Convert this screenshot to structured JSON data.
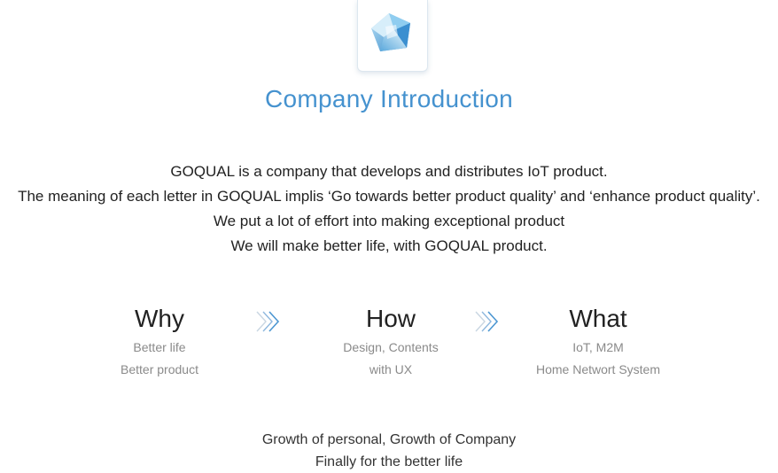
{
  "header": {
    "logo_icon": "pentagon-gem-logo-icon",
    "title": "Company Introduction",
    "title_color": "#4592cf"
  },
  "intro": {
    "lines": [
      "GOQUAL is a company that develops and distributes IoT product.",
      "The meaning of each letter in GOQUAL implis ‘Go towards better product quality’ and ‘enhance product quality’.",
      "We put a lot of effort into making exceptional product",
      "We will make better life, with GOQUAL product."
    ]
  },
  "pillars": [
    {
      "heading": "Why",
      "lines": [
        "Better life",
        "Better product"
      ]
    },
    {
      "heading": "How",
      "lines": [
        "Design, Contents",
        "with UX"
      ]
    },
    {
      "heading": "What",
      "lines": [
        "IoT, M2M",
        "Home Networt System"
      ]
    }
  ],
  "arrows": {
    "icon": "triple-chevron-right-icon",
    "color": "#5a9fd4"
  },
  "footer": {
    "lines": [
      "Growth of personal, Growth of Company",
      "Finally for the better life"
    ]
  }
}
